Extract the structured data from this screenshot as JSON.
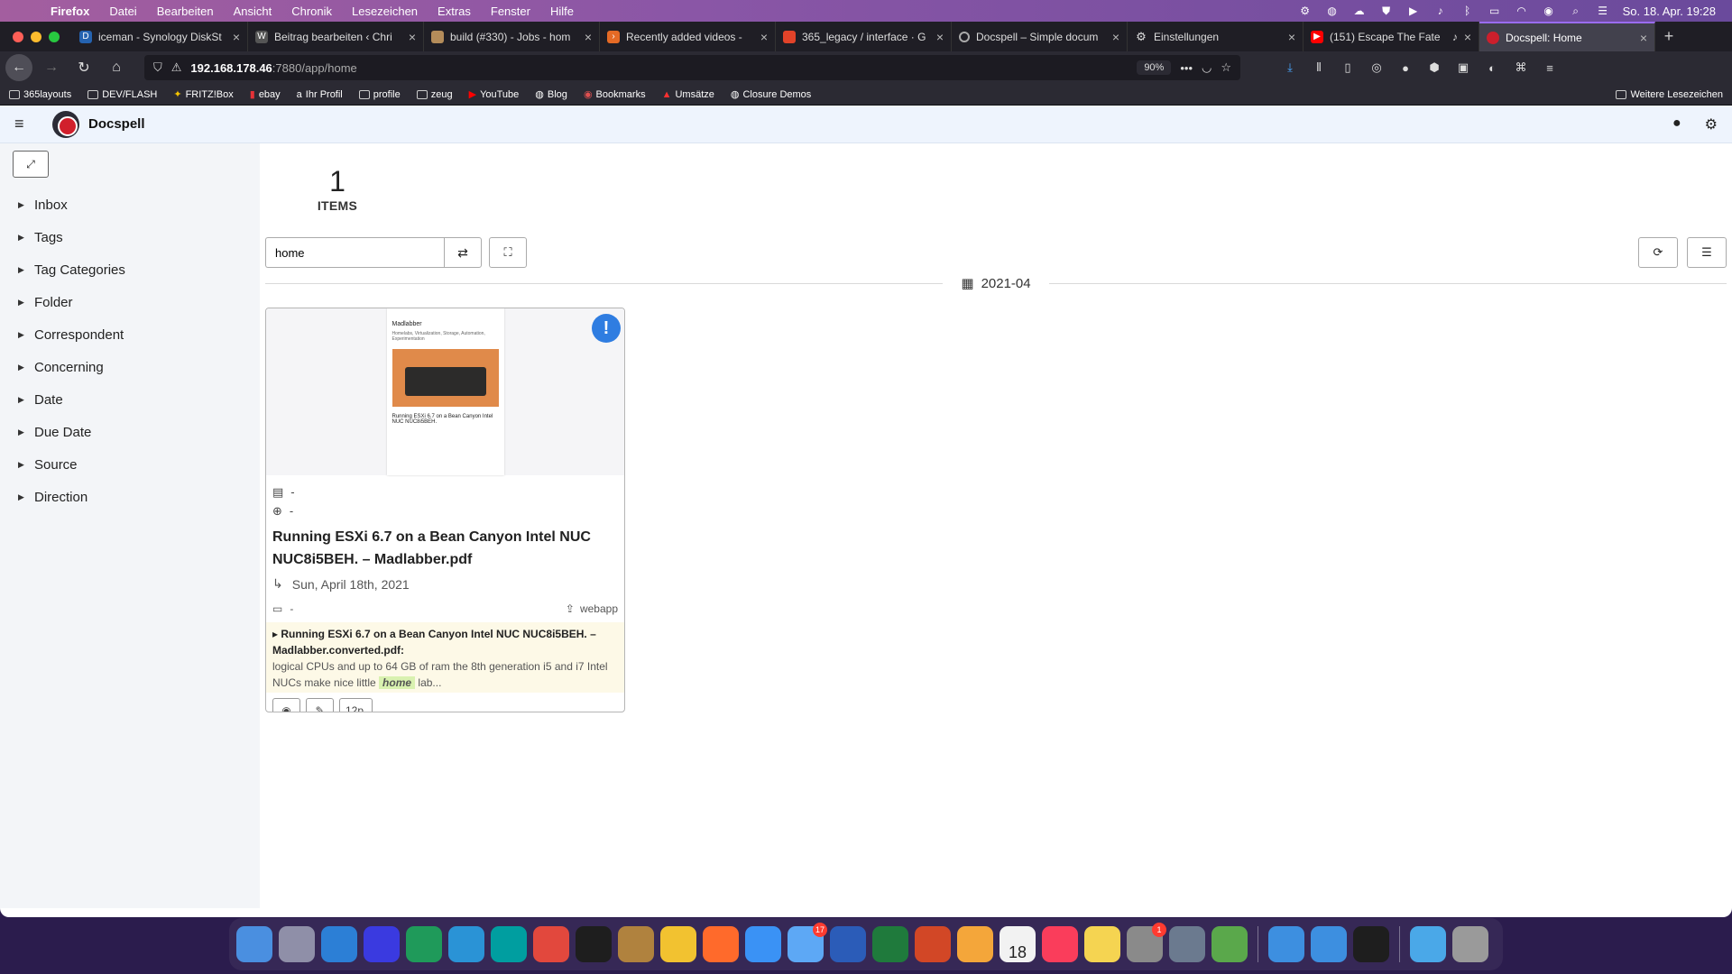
{
  "menubar": {
    "app": "Firefox",
    "menus": [
      "Datei",
      "Bearbeiten",
      "Ansicht",
      "Chronik",
      "Lesezeichen",
      "Extras",
      "Fenster",
      "Hilfe"
    ],
    "clock": "So. 18. Apr. 19:28"
  },
  "tabs": [
    {
      "label": "iceman - Synology DiskSt",
      "color": "#2563b0"
    },
    {
      "label": "Beitrag bearbeiten ‹ Chri",
      "color": "#555555"
    },
    {
      "label": "build (#330) - Jobs - hom",
      "color": "#b48c5a"
    },
    {
      "label": "Recently added videos -",
      "color": "#e56a25"
    },
    {
      "label": "365_legacy / interface · G",
      "color": "#e24329"
    },
    {
      "label": "Docspell – Simple docum",
      "color": "#888888"
    },
    {
      "label": "Einstellungen",
      "color": "#888888"
    },
    {
      "label": "(151) Escape The Fate",
      "color": "#ff0000"
    },
    {
      "label": "Docspell: Home",
      "color": "#cc1f2c"
    }
  ],
  "url": {
    "host": "192.168.178.46",
    "path": ":7880/app/home",
    "zoom": "90%"
  },
  "bookmarks": [
    "365layouts",
    "DEV/FLASH",
    "FRITZ!Box",
    "ebay",
    "Ihr Profil",
    "profile",
    "zeug",
    "YouTube",
    "Blog",
    "Bookmarks",
    "Umsätze",
    "Closure Demos"
  ],
  "bookmarks_more": "Weitere Lesezeichen",
  "app": {
    "brand": "Docspell"
  },
  "sidebar": {
    "items": [
      "Inbox",
      "Tags",
      "Tag Categories",
      "Folder",
      "Correspondent",
      "Concerning",
      "Date",
      "Due Date",
      "Source",
      "Direction"
    ]
  },
  "stats": {
    "count": "1",
    "label": "ITEMS"
  },
  "search": {
    "value": "home"
  },
  "month": "2021-04",
  "card": {
    "correspondent": "-",
    "concerning": "-",
    "title": "Running ESXi 6.7 on a Bean Canyon Intel NUC NUC8i5BEH. – Madlabber.pdf",
    "date": "Sun, April 18th, 2021",
    "folder": "-",
    "source": "webapp",
    "preview": {
      "site": "Madlabber",
      "tagline": "Homelabs, Virtualization, Storage, Automation, Experimentation",
      "heading": "Running ESXi 6.7 on a Bean Canyon Intel NUC NUC8i5BEH."
    },
    "highlight": {
      "file": "Running ESXi 6.7 on a Bean Canyon Intel NUC NUC8i5BEH. – Madlabber.converted.pdf:",
      "before": "logical CPUs and up to 64 GB of ram the 8th generation i5 and i7 Intel NUCs make nice little",
      "match": "home",
      "after": "lab..."
    },
    "pages": "12p."
  },
  "dock": {
    "apps": [
      "#4a8fe0",
      "#8f8fa8",
      "#2c7fd6",
      "#3a3ae0",
      "#1f9a5a",
      "#2a93d6",
      "#009ea0",
      "#e2483d",
      "#1e1e1e",
      "#b0823e",
      "#f2c230",
      "#ff6a2b",
      "#3a92f5",
      "#5da8f5",
      "#2b5cb8",
      "#1f7a3c",
      "#d24726",
      "#f4a63a",
      "#f2f2f2",
      "#fa3d5b",
      "#f5d451",
      "#8a8a8a",
      "#6b7a8f",
      "#5aa84b",
      "#3d8fe0",
      "#3d8fe0",
      "#1e1e1e",
      "#4aa8e8",
      "#9a9a9a"
    ],
    "mail_badge": "17",
    "settings_badge": "1",
    "calendar_day": "18"
  }
}
